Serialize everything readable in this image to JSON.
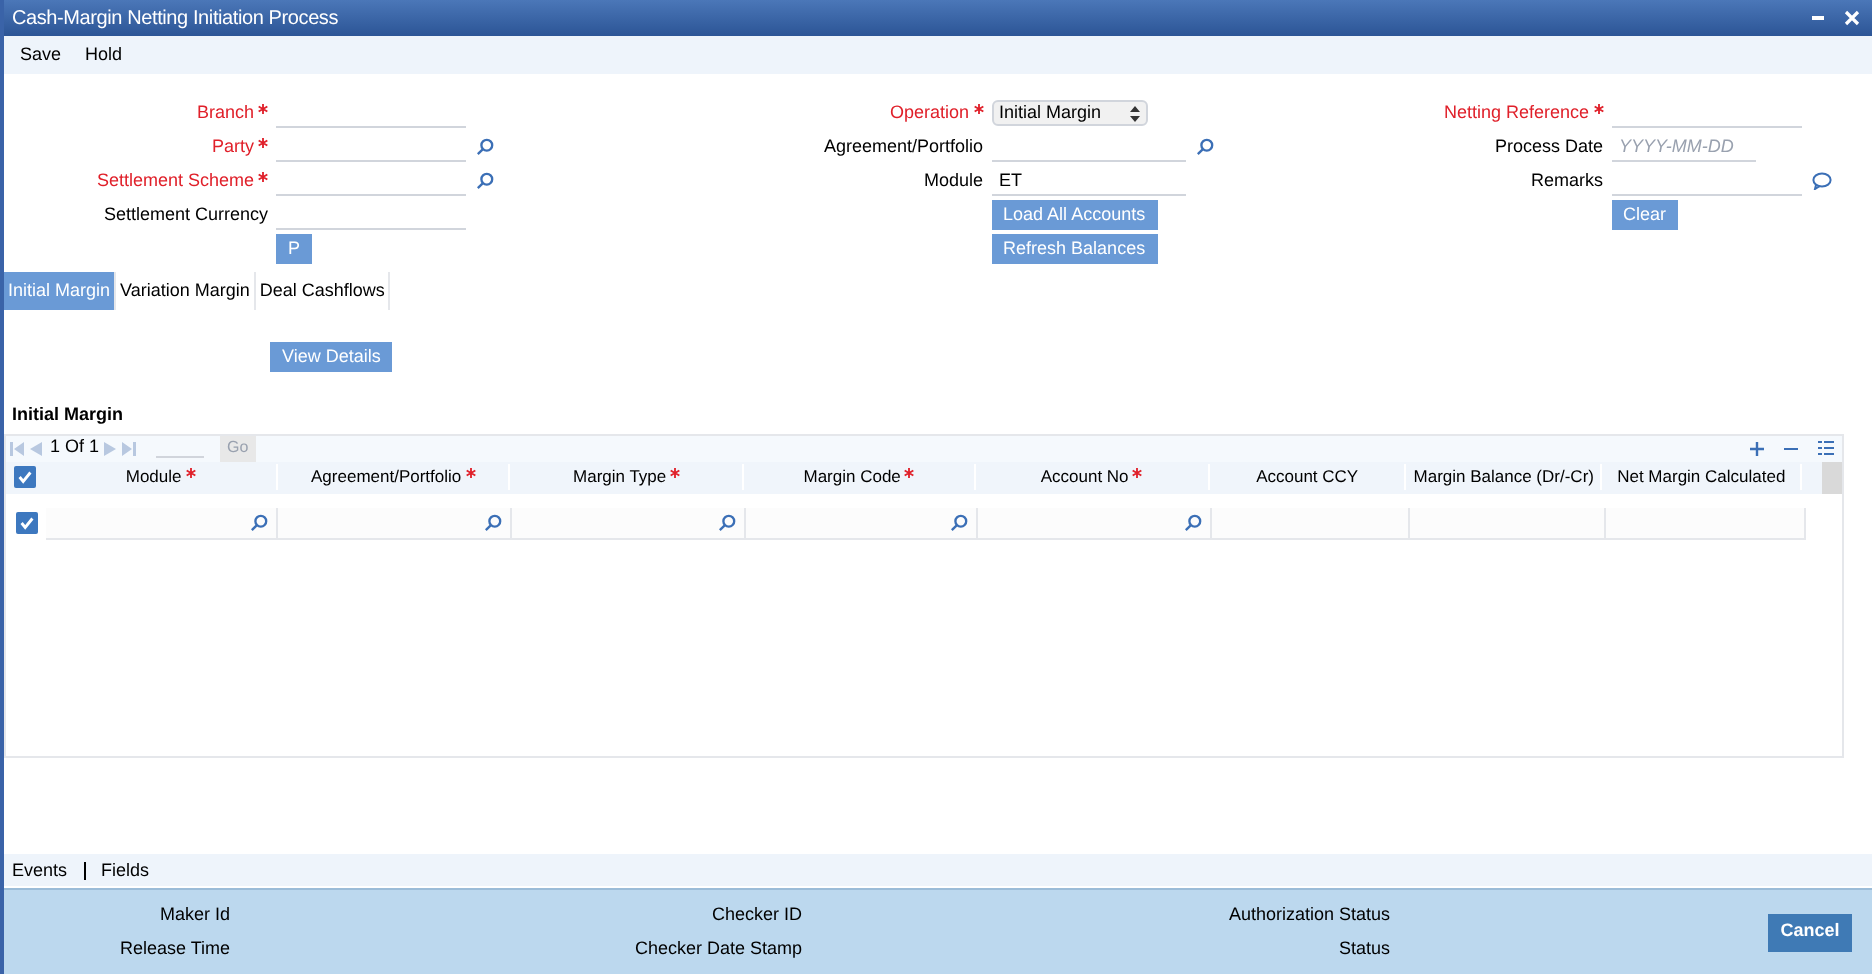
{
  "window": {
    "title": "Cash-Margin Netting Initiation Process"
  },
  "toolbar": [
    "Save",
    "Hold"
  ],
  "form": {
    "columns": [
      [
        {
          "kind": "field",
          "label": "Branch",
          "required": true
        },
        {
          "kind": "lookup",
          "label": "Party",
          "required": true
        },
        {
          "kind": "lookup",
          "label": "Settlement Scheme",
          "required": true
        },
        {
          "kind": "field",
          "label": "Settlement Currency",
          "required": false
        },
        {
          "kind": "button",
          "label": "P"
        }
      ],
      [
        {
          "kind": "select",
          "label": "Operation",
          "required": true,
          "value": "Initial Margin"
        },
        {
          "kind": "lookup",
          "label": "Agreement/Portfolio",
          "required": false
        },
        {
          "kind": "field",
          "label": "Module",
          "required": false,
          "value": "ET"
        },
        {
          "kind": "button",
          "label": "Load All Accounts"
        },
        {
          "kind": "button",
          "label": "Refresh Balances"
        }
      ],
      [
        {
          "kind": "field",
          "label": "Netting Reference",
          "required": true
        },
        {
          "kind": "date",
          "label": "Process Date",
          "required": false,
          "placeholder": "YYYY-MM-DD"
        },
        {
          "kind": "remarks",
          "label": "Remarks",
          "required": false
        },
        {
          "kind": "button",
          "label": "Clear"
        }
      ]
    ]
  },
  "tabs": [
    {
      "label": "Initial Margin",
      "selected": true
    },
    {
      "label": "Variation Margin",
      "selected": false
    },
    {
      "label": "Deal Cashflows",
      "selected": false
    }
  ],
  "view_details": "View Details",
  "grid": {
    "title": "Initial Margin",
    "pager": "1 Of 1",
    "go": "Go",
    "header_checked": true,
    "columns": [
      {
        "label": "Module",
        "required": true
      },
      {
        "label": "Agreement/Portfolio",
        "required": true
      },
      {
        "label": "Margin Type",
        "required": true
      },
      {
        "label": "Margin Code",
        "required": true
      },
      {
        "label": "Account No",
        "required": true
      },
      {
        "label": "Account CCY",
        "required": false
      },
      {
        "label": "Margin Balance (Dr/-Cr)",
        "required": false
      },
      {
        "label": "Net Margin Calculated",
        "required": false
      }
    ],
    "rows": [
      {
        "checked": true,
        "lookups": [
          true,
          true,
          true,
          true,
          true,
          false,
          false,
          false
        ]
      }
    ]
  },
  "links": [
    "Events",
    "Fields"
  ],
  "audit": [
    [
      "Maker Id",
      "Release Time"
    ],
    [
      "Checker ID",
      "Checker Date Stamp"
    ],
    [
      "Authorization Status",
      "Status"
    ]
  ],
  "cancel": "Cancel"
}
